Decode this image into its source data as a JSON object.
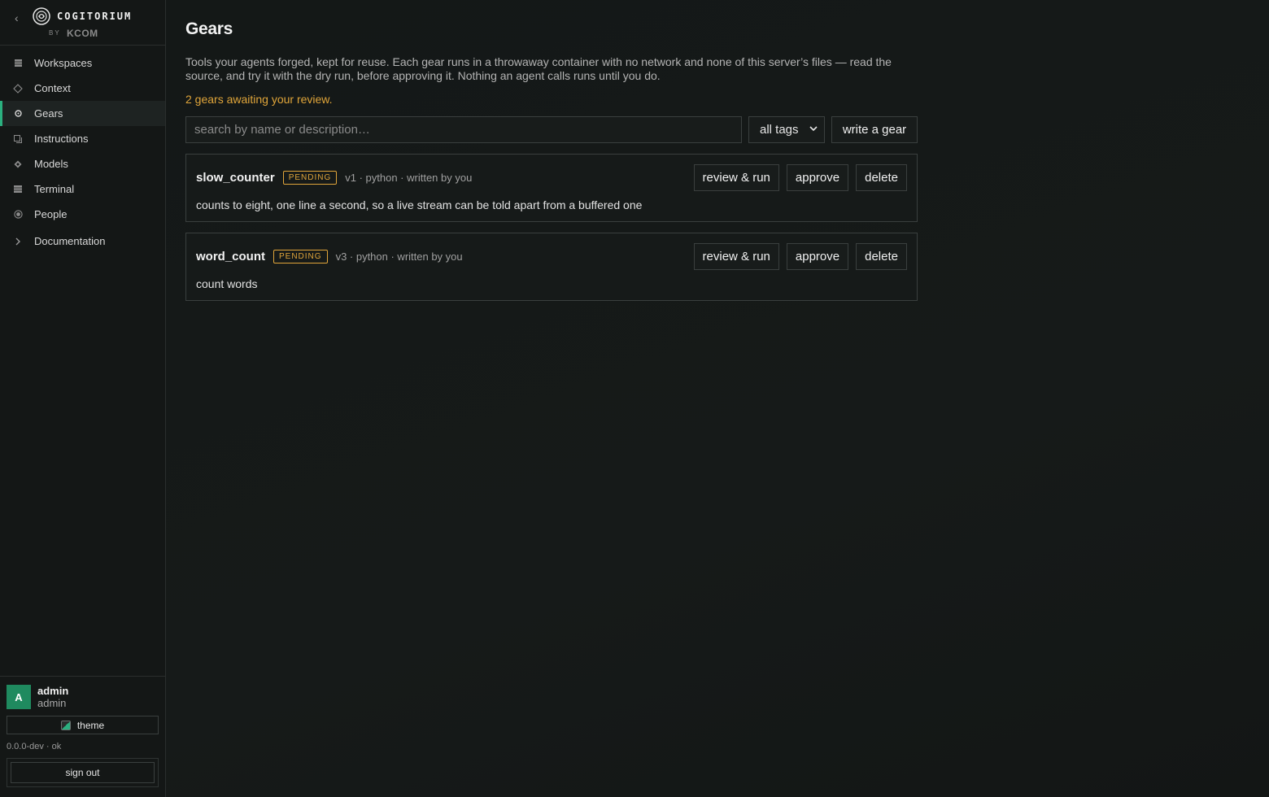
{
  "brand": {
    "name": "COGITORIUM",
    "by": "BY",
    "company": "KCOM",
    "collapse_icon": "chevron-left-icon"
  },
  "nav": {
    "items": [
      {
        "label": "Workspaces",
        "icon": "workspaces-icon",
        "active": false
      },
      {
        "label": "Context",
        "icon": "diamond-icon",
        "active": false
      },
      {
        "label": "Gears",
        "icon": "gear-icon",
        "active": true
      },
      {
        "label": "Instructions",
        "icon": "instructions-icon",
        "active": false
      },
      {
        "label": "Models",
        "icon": "models-icon",
        "active": false
      },
      {
        "label": "Terminal",
        "icon": "terminal-icon",
        "active": false
      },
      {
        "label": "People",
        "icon": "people-icon",
        "active": false
      },
      {
        "label": "Documentation",
        "icon": "chevron-right-icon",
        "active": false
      }
    ]
  },
  "user": {
    "initial": "A",
    "name": "admin",
    "role": "admin"
  },
  "theme_label": "theme",
  "version": "0.0.0-dev · ok",
  "signout_label": "sign out",
  "page": {
    "title": "Gears",
    "description": "Tools your agents forged, kept for reuse. Each gear runs in a throwaway container with no network and none of this server’s files — read the source, and try it with the dry run, before approving it. Nothing an agent calls runs until you do.",
    "awaiting": "2 gears awaiting your review."
  },
  "toolbar": {
    "search_placeholder": "search by name or description…",
    "tags_value": "all tags",
    "write_label": "write a gear"
  },
  "gears": [
    {
      "name": "slow_counter",
      "status": "PENDING",
      "meta": "v1 · python · written by you",
      "description": "counts to eight, one line a second, so a live stream can be told apart from a buffered one",
      "review_label": "review & run",
      "approve_label": "approve",
      "delete_label": "delete"
    },
    {
      "name": "word_count",
      "status": "PENDING",
      "meta": "v3 · python · written by you",
      "description": "count words",
      "review_label": "review & run",
      "approve_label": "approve",
      "delete_label": "delete"
    }
  ],
  "colors": {
    "accent": "#2bb07f",
    "pending": "#e0a53a",
    "avatar": "#1f8a5f"
  }
}
